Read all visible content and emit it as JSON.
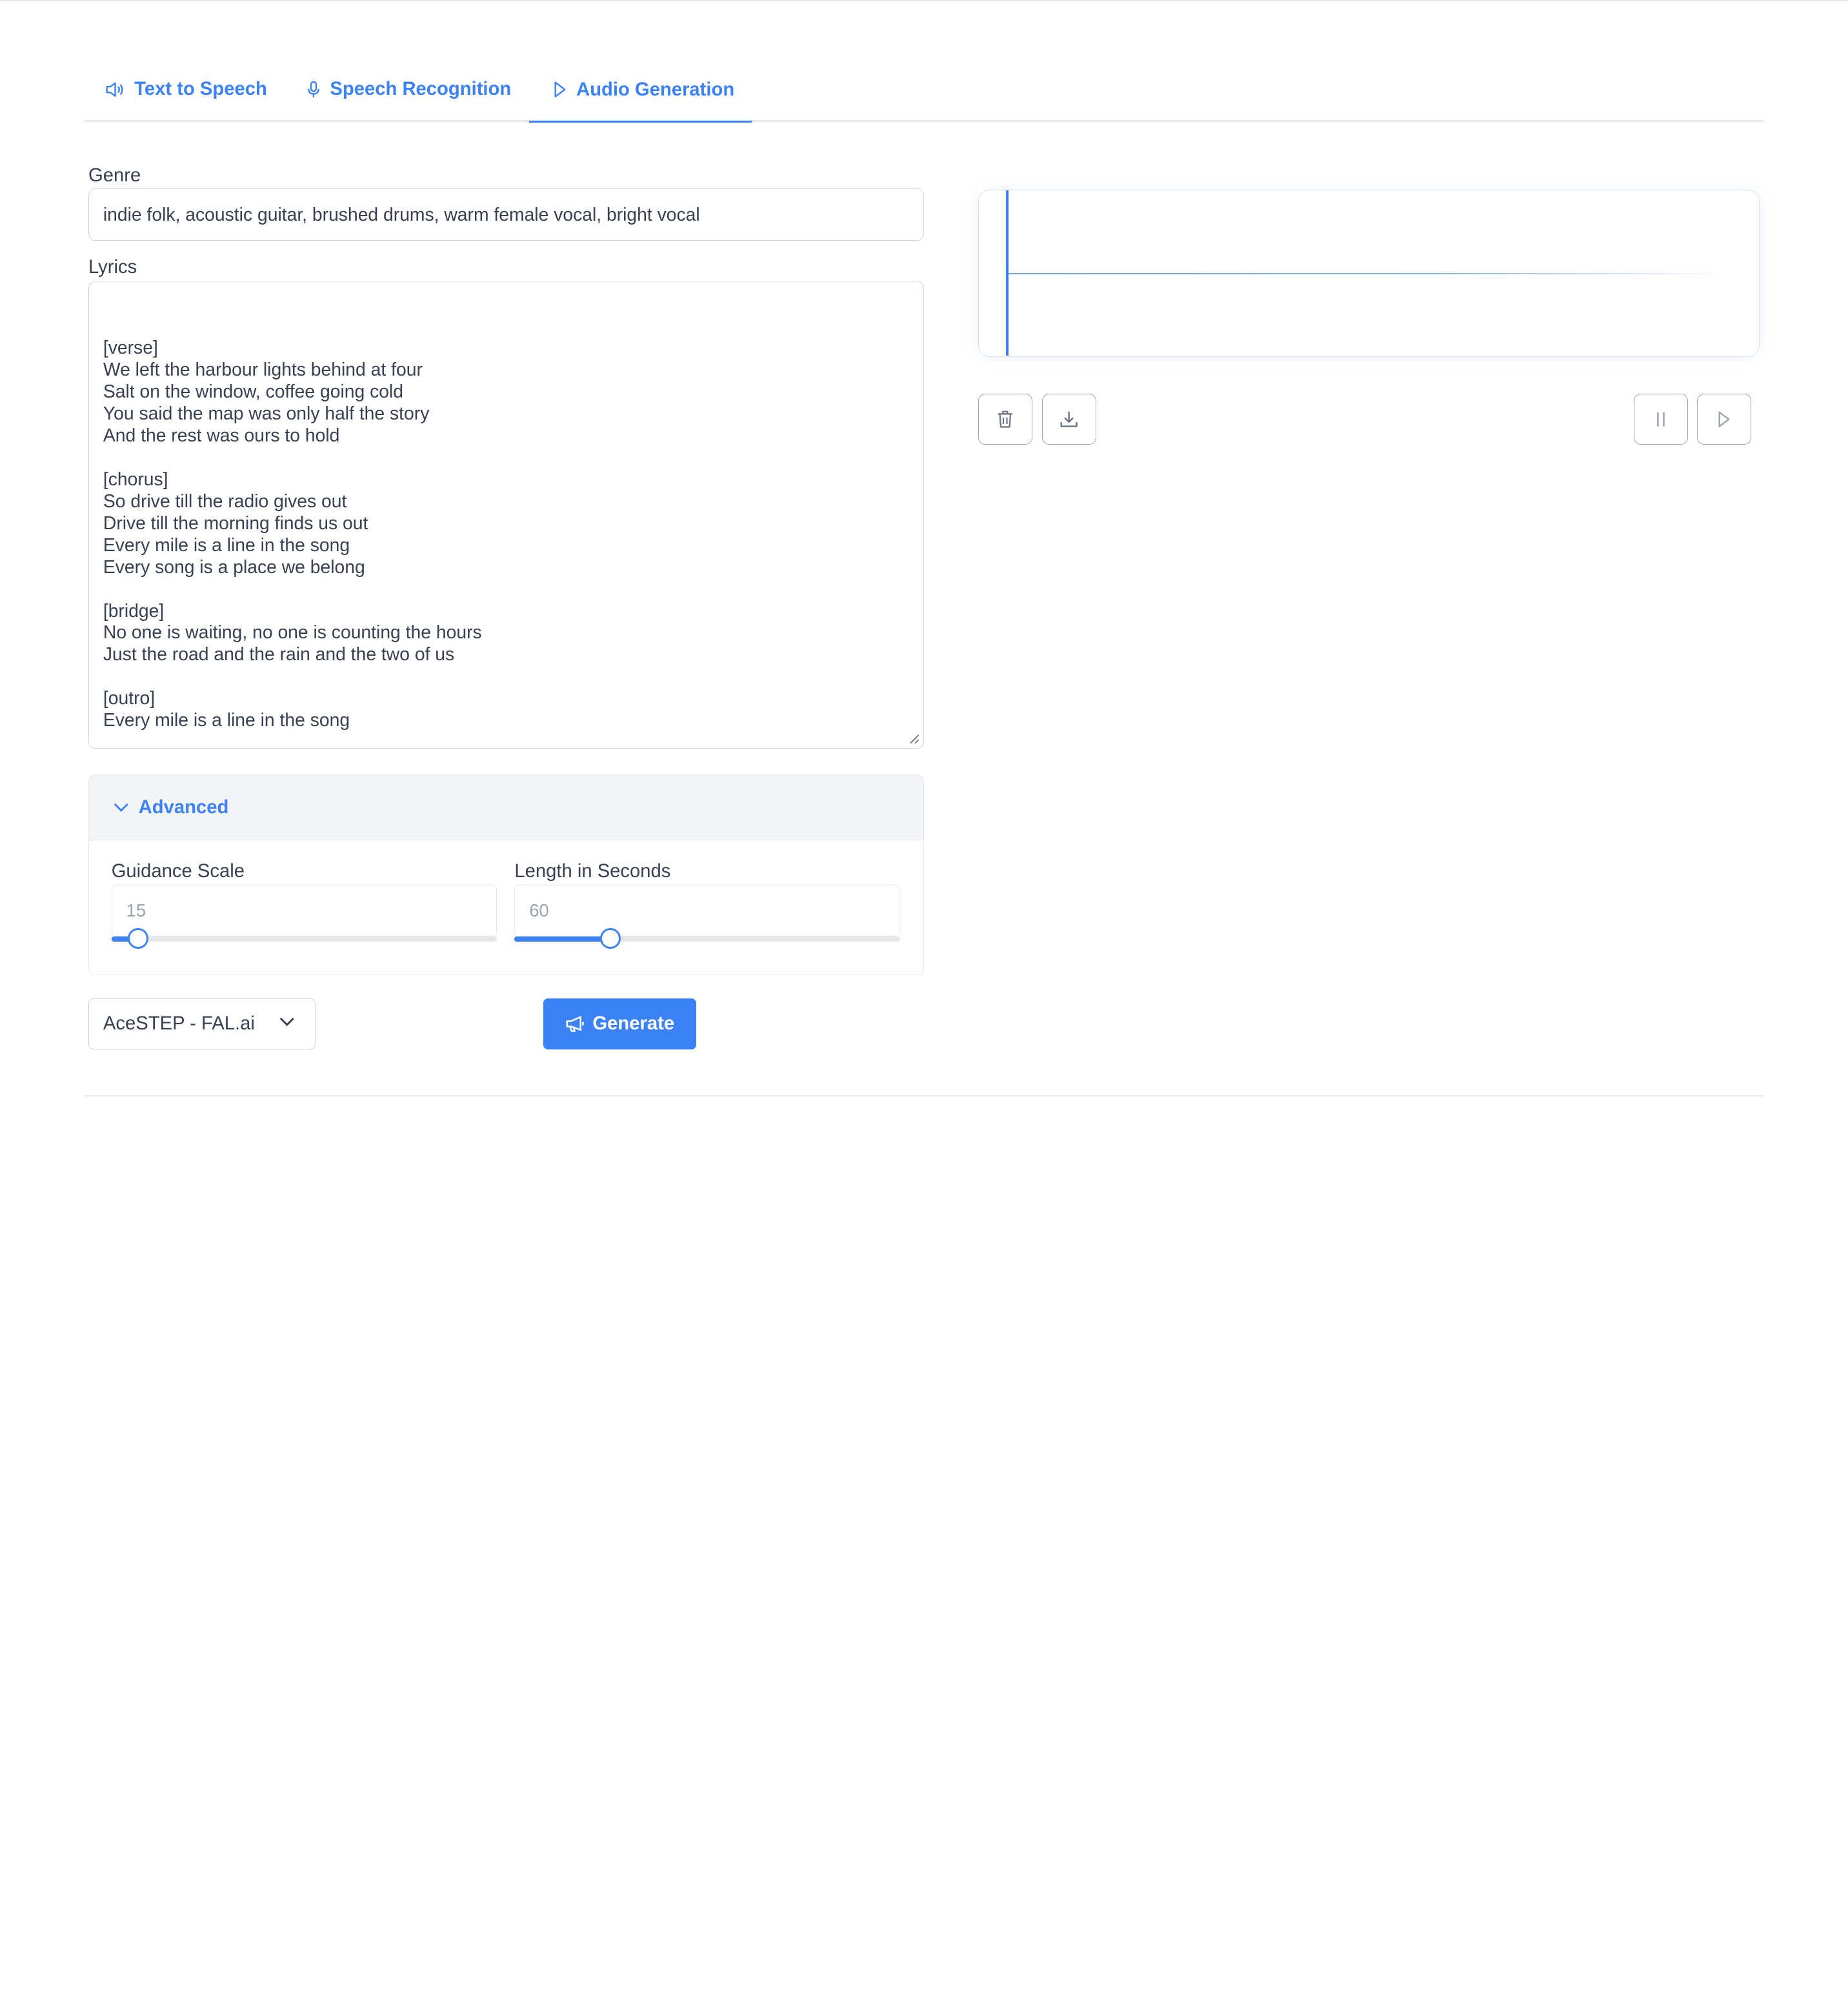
{
  "tabs": [
    {
      "label": "Text to Speech",
      "icon": "speaker-icon",
      "active": false
    },
    {
      "label": "Speech Recognition",
      "icon": "microphone-icon",
      "active": false
    },
    {
      "label": "Audio Generation",
      "icon": "play-icon",
      "active": true
    }
  ],
  "form": {
    "genre_label": "Genre",
    "genre_value": "indie folk, acoustic guitar, brushed drums, warm female vocal, bright vocal",
    "lyrics_label": "Lyrics",
    "lyrics_value": "[verse]\nWe left the harbour lights behind at four\nSalt on the window, coffee going cold\nYou said the map was only half the story\nAnd the rest was ours to hold\n\n[chorus]\nSo drive till the radio gives out\nDrive till the morning finds us out\nEvery mile is a line in the song\nEvery song is a place we belong\n\n[bridge]\nNo one is waiting, no one is counting the hours\nJust the road and the rain and the two of us\n\n[outro]\nEvery mile is a line in the song"
  },
  "advanced": {
    "title": "Advanced",
    "guidance": {
      "label": "Guidance Scale",
      "value": "15",
      "slider_fraction": 0.07
    },
    "length": {
      "label": "Length in Seconds",
      "value": "60",
      "slider_fraction": 0.25
    }
  },
  "model_select": {
    "value": "AceSTEP - FAL.ai"
  },
  "generate_label": "Generate",
  "player": {
    "buttons": [
      "trash-icon",
      "download-icon",
      "pause-icon",
      "play-icon"
    ]
  },
  "colors": {
    "accent": "#3b82f6",
    "border": "#d1d5db",
    "panel_bg": "#f3f4f6"
  }
}
